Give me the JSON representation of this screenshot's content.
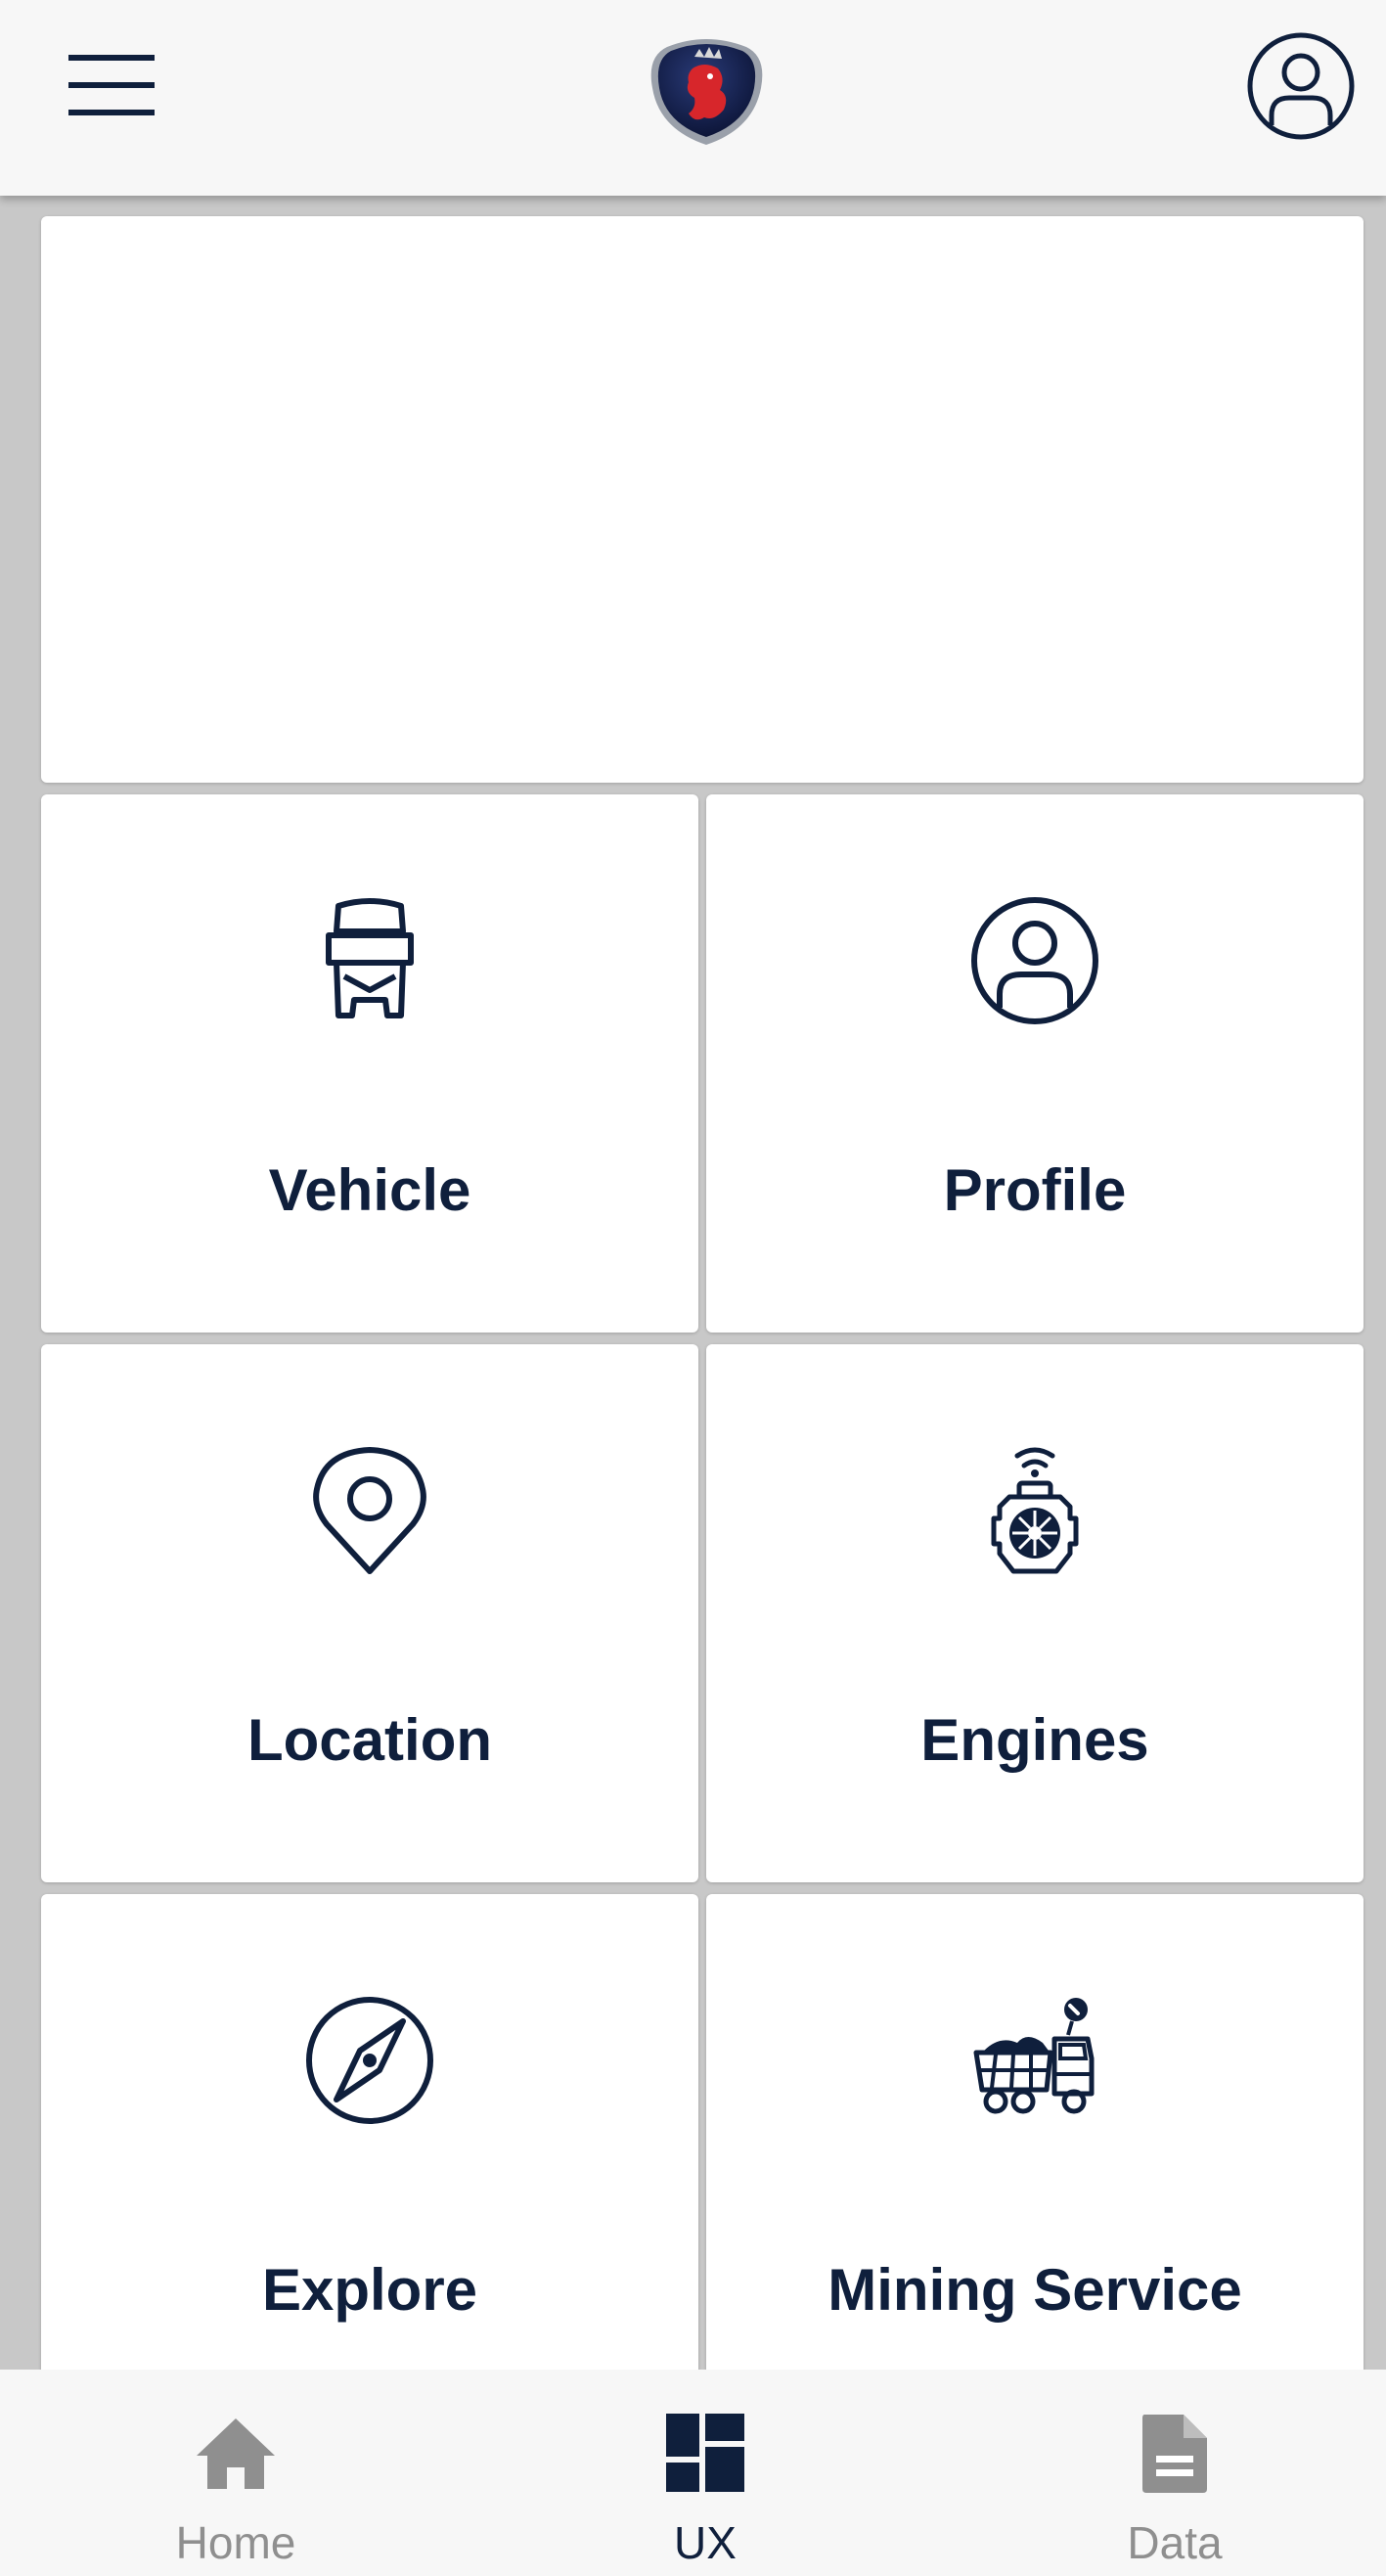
{
  "colors": {
    "primary": "#0f1f3c",
    "inactive": "#8f8f8f",
    "background": "#c8c8c8",
    "surface": "#ffffff",
    "bar": "#f7f7f7",
    "logo_red": "#d7262b"
  },
  "header": {
    "menu_icon": "hamburger-menu-icon",
    "logo_icon": "griffin-brand-logo",
    "account_icon": "user-account-icon"
  },
  "tiles": [
    {
      "label": "Vehicle",
      "icon": "truck-front-icon"
    },
    {
      "label": "Profile",
      "icon": "user-circle-icon"
    },
    {
      "label": "Location",
      "icon": "map-pin-icon"
    },
    {
      "label": "Engines",
      "icon": "connected-engine-icon"
    },
    {
      "label": "Explore",
      "icon": "compass-icon"
    },
    {
      "label": "Mining Service",
      "icon": "mining-truck-icon"
    }
  ],
  "bottom_nav": {
    "items": [
      {
        "label": "Home",
        "icon": "home-icon",
        "active": false
      },
      {
        "label": "UX",
        "icon": "dashboard-icon",
        "active": true
      },
      {
        "label": "Data",
        "icon": "document-icon",
        "active": false
      }
    ]
  }
}
